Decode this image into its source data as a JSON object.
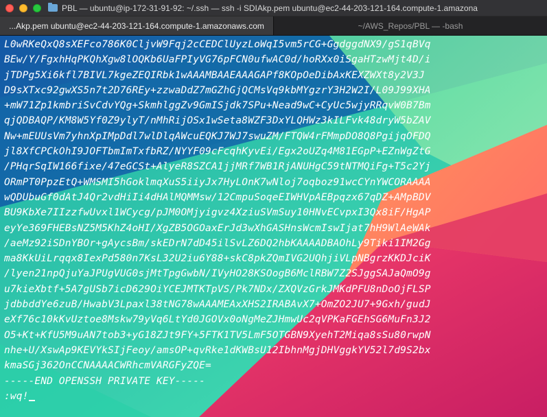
{
  "window": {
    "title": "PBL — ubuntu@ip-172-31-91-92: ~/.ssh — ssh -i SDIAkp.pem ubuntu@ec2-44-203-121-164.compute-1.amazona",
    "colors": {
      "close": "#ff5f57",
      "minimize": "#febc2e",
      "zoom": "#28c840"
    }
  },
  "tabs": [
    {
      "label": "...Akp.pem ubuntu@ec2-44-203-121-164.compute-1.amazonaws.com",
      "active": true
    },
    {
      "label": "~/AWS_Repos/PBL — -bash",
      "active": false
    }
  ],
  "terminal": {
    "lines": [
      "L0wRKeQxQ8sXEFco786K0CljvW9Fqj2cCEDClUyzLoWqI5vm5rCG+GgdggdNX9/gS1qBVq",
      "BEw/Y/FgxhHqPKQhXgw8lOQKb6UaFPIyVG76pFCN0ufwAC0d/hoRXx0iSgaHTzwMjt4D/i",
      "jTDPg5Xi6kfl7BIVL7kgeZEQIRbk1wAAAMBAAEAAAGAPf8KOpOeDibAxKEXZWXt8y2V3J",
      "D9sXTxc92gwXS5n7t2D76REy+zzwaDdZ7mGZhGjQCMsVq9kbMYgzrY3H2W2I/L09J99XHA",
      "+mW71Zp1kmbriSvCdvYQg+SkmhlggZv9GmISjdk7SPu+Nead9wC+CyUc5wjyRRqvW0B7Bm",
      "qjQDBAQP/KM8W5Yf0Z9ylyT/nMhRijOSx1wSeta8WZF3DxYLQHWz3kILFvk48dryW5bZAV",
      "Nw+mEUUsVm7yhnXpIMpDdl7wlDlqAWcuEQKJ7WJ7swuZM/FTQW4rFMmpDO8Q8PgijqOFDQ",
      "jl8XfCPCkOhI9JOFTbmImTxfbRZ/NYYF09cFcqhKyvEi/Egx2oUZq4M81EGpP+EZnWgZtG",
      "/PHqrSqIW166fixe/47eGCSt+AlyeR8SZCA1jjMRf7WB1RjANUHgC59tNTMQiFg+T5c2Yj",
      "ORmPT0PpzEtQ+WMSMI5hGoklmqXuS5iiyJx7HyLOnK7wNloj7oqboz91wcCYnYWCORAAAA",
      "wQDUbuGf0dAtJ4Qr2vdHiIi4dHAlMQMMsw/12CmpuSoqeEIWHVpAEBpqzx67qDZ+AMpBDV",
      "BU9KbXe7IIzzfwUvxl1WCycg/pJM0OMjyigvz4XziuSVmSuy10HNvECvpxI3Qx8iF/HgAP",
      "eyYe369FHEBsNZ5M5KhZ4oHI/XgZB5OGOaxErJd3wXhGASHnsWcmIswIjat7hH9WlAeWAk",
      "/aeMz92iSDnYBOr+gAycsBm/skEDrN7dD45ilSvLZ6DQ2hbKAAAADBAOhLy9Tiki1IM2Gg",
      "ma8KkUiLrqqx8IexPd580n7KsL32U2iu6Y88+skC8pkZQmIVG2UQhjiVLpNBgrzKKDJciK",
      "/lyen21npQjuYaJPUgVUG0sjMtTpgGwbN/IVyHO28KSOogB6MclRBW7Z2SJggSAJaQmO9g",
      "u7kieXbtf+5A7gUSb7icD629OiYCEJMTKTpVS/Pk7NDx/ZXQVzGrkJMKdPFU8nDoOjFLSP",
      "jdbbddYe6zuB/HwabV3Lpaxl38tNG78wAAAMEAxXHS2IRABAvX7+OmZO2JU7+9Gxh/gudJ",
      "eXf76c10kKvUztoe8Mskw79yVq6LtYd0JGOVx0oNgMeZJHmwUc2qVPKaFGEhSG6MuFn3J2",
      "O5+Kt+KfU5M9uAN7tob3+yG18ZJt9FY+5FTK1TV5LmF5OTGBN9XyehT2Miqa8sSu80rwpN",
      "nhe+U/XswAp9KEVYkSIjFeoy/amsOP+qvRke1dKWBsU12IbhnMgjDHVggkYV52l7d9S2bx",
      "kmaSGj362OnCCNAAAACWRhcmVARGFyZQE=",
      "-----END OPENSSH PRIVATE KEY-----",
      ":wq!"
    ]
  }
}
